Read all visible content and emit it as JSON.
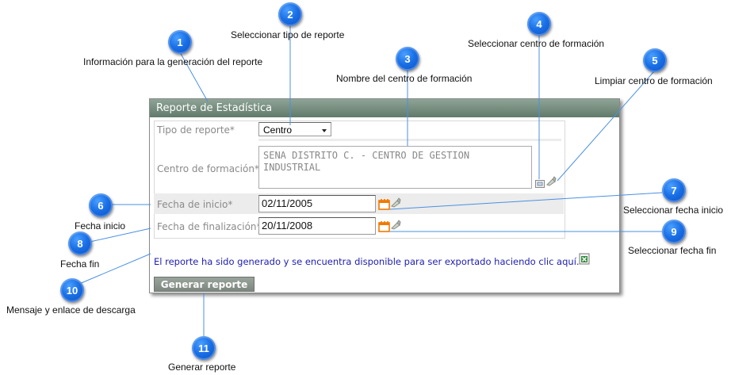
{
  "panel": {
    "title": "Reporte de Estadística",
    "tipo_label": "Tipo de reporte*",
    "tipo_value": "Centro",
    "centro_label": "Centro de formación*",
    "centro_value": "SENA DISTRITO C. - CENTRO DE GESTION INDUSTRIAL",
    "inicio_label": "Fecha de inicio*",
    "inicio_value": "02/11/2005",
    "fin_label": "Fecha de finalización*",
    "fin_value": "20/11/2008",
    "message": "El reporte ha sido generado y se encuentra disponible para ser exportado haciendo clic aquí.",
    "button": "Generar reporte"
  },
  "callouts": [
    {
      "n": "1",
      "text": "Información para la generación del reporte"
    },
    {
      "n": "2",
      "text": "Seleccionar tipo de reporte"
    },
    {
      "n": "3",
      "text": "Nombre del centro de formación"
    },
    {
      "n": "4",
      "text": "Seleccionar centro de formación"
    },
    {
      "n": "5",
      "text": "Limpiar centro de formación"
    },
    {
      "n": "6",
      "text": "Fecha inicio"
    },
    {
      "n": "7",
      "text": "Seleccionar fecha inicio"
    },
    {
      "n": "8",
      "text": "Fecha fin"
    },
    {
      "n": "9",
      "text": "Seleccionar fecha fin"
    },
    {
      "n": "10",
      "text": "Mensaje y enlace de descarga"
    },
    {
      "n": "11",
      "text": "Generar reporte"
    }
  ],
  "colors": {
    "badge": "#1a6fe6",
    "title_bar": "#617a6b",
    "link": "#2020b0",
    "button": "#7d877f"
  },
  "icons": [
    "calendar-icon",
    "clear-icon",
    "select-centro-icon",
    "excel-icon"
  ]
}
